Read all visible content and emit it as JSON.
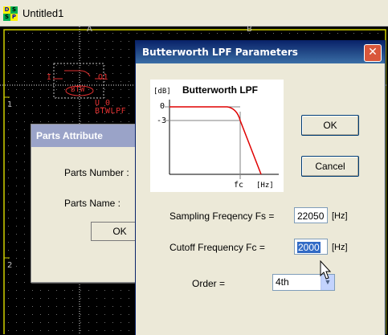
{
  "app": {
    "title": "Untitled1",
    "icon_letters": [
      "D",
      "S",
      "S",
      "P"
    ]
  },
  "canvas": {
    "columns": [
      "A",
      "B"
    ],
    "rows": [
      "1",
      "2"
    ],
    "part_ref": "U_0",
    "part_name": "BTWLPF",
    "pin_in": "I",
    "pin_out": "O1",
    "block_label": "BTW"
  },
  "parts_dialog": {
    "title": "Parts Attribute",
    "number_label": "Parts Number :",
    "name_label": "Parts Name :",
    "ok_label": "OK"
  },
  "bw_dialog": {
    "title": "Butterworth LPF Parameters",
    "close_glyph": "✕",
    "plot": {
      "title": "Butterworth LPF",
      "unit_y": "[dB]",
      "tick_0": "0",
      "tick_m3": "-3",
      "fc_label": "fc",
      "unit_x": "[Hz]"
    },
    "ok_label": "OK",
    "cancel_label": "Cancel",
    "fs_label": "Sampling Freqency Fs =",
    "fs_value": "22050",
    "fs_unit": "[Hz]",
    "fc_field_label": "Cutoff Frequency Fc =",
    "fc_value": "2000",
    "fc_unit": "[Hz]",
    "order_label": "Order =",
    "order_value": "4th"
  },
  "colors": {
    "schematic_red": "#e23030",
    "title_blue": "#0a246a",
    "close_red": "#d9573b",
    "selection": "#316ac5"
  }
}
